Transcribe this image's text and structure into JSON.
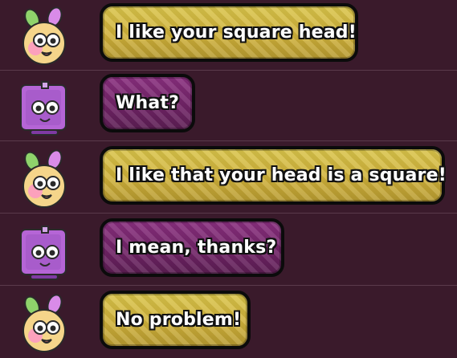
{
  "chat": {
    "messages": [
      {
        "speaker": "bunny",
        "text": "I like your square head!",
        "bubble_color": "#cfb13a"
      },
      {
        "speaker": "cube",
        "text": "What?",
        "bubble_color": "#6f2365"
      },
      {
        "speaker": "bunny",
        "text": "I like that your head is a square!",
        "bubble_color": "#cfb13a"
      },
      {
        "speaker": "cube",
        "text": "I mean, thanks?",
        "bubble_color": "#6f2365"
      },
      {
        "speaker": "bunny",
        "text": "No problem!",
        "bubble_color": "#cfb13a"
      }
    ],
    "icons": {
      "bunny": "bunny-avatar-icon",
      "cube": "cube-avatar-icon"
    },
    "colors": {
      "background": "#3a1a2b",
      "yellow_bubble": "#cfb13a",
      "purple_bubble": "#6f2365",
      "outline": "#0b0b0b"
    }
  }
}
